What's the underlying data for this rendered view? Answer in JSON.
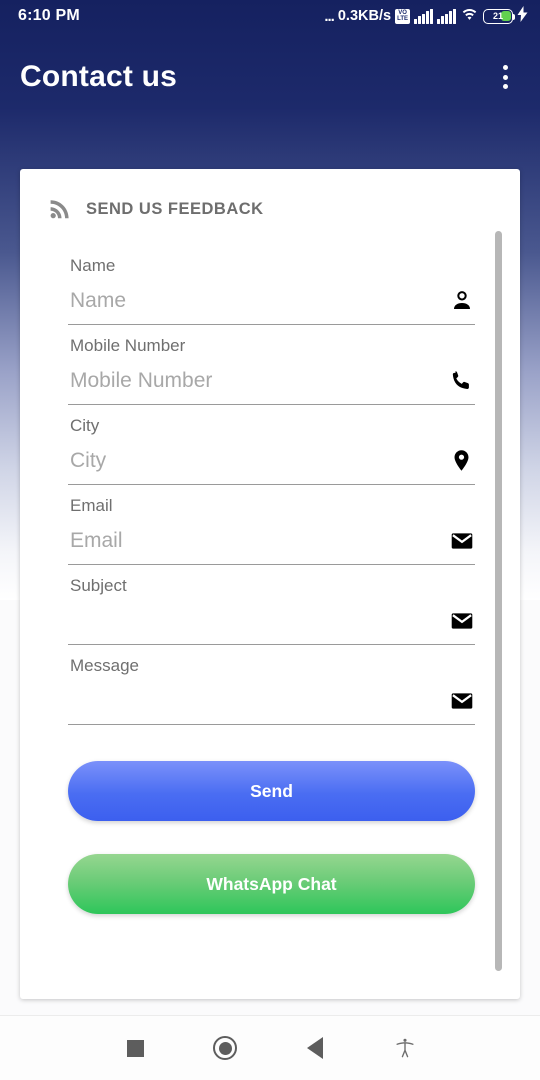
{
  "status_bar": {
    "time": "6:10 PM",
    "dots": "...",
    "network_speed": "0.3KB/s",
    "volte_top": "VO",
    "volte_bottom": "LTE",
    "battery_percent": "21",
    "icons": [
      "volte-icon",
      "signal-bars-sim1-icon",
      "signal-bars-sim2-icon",
      "wifi-icon",
      "battery-icon",
      "charging-bolt-icon"
    ]
  },
  "app_bar": {
    "title": "Contact us",
    "overflow_icon": "more-vert-icon"
  },
  "card": {
    "header_icon": "rss-feed-icon",
    "header_title": "SEND US FEEDBACK",
    "fields": [
      {
        "label": "Name",
        "placeholder": "Name",
        "value": "",
        "icon": "person-icon"
      },
      {
        "label": "Mobile Number",
        "placeholder": "Mobile Number",
        "value": "",
        "icon": "phone-icon"
      },
      {
        "label": "City",
        "placeholder": "City",
        "value": "",
        "icon": "location-pin-icon"
      },
      {
        "label": "Email",
        "placeholder": "Email",
        "value": "",
        "icon": "email-icon"
      },
      {
        "label": "Subject",
        "placeholder": "",
        "value": "",
        "icon": "email-icon"
      },
      {
        "label": "Message",
        "placeholder": "",
        "value": "",
        "icon": "email-icon"
      }
    ],
    "buttons": {
      "send": "Send",
      "whatsapp": "WhatsApp Chat"
    }
  },
  "nav_bar": {
    "recents": "recents-square-icon",
    "home": "home-circle-icon",
    "back": "back-triangle-icon",
    "accessibility": "accessibility-icon"
  },
  "colors": {
    "app_bar_dark": "#152160",
    "send_button": "#4a6df2",
    "whatsapp_button": "#2ec65a",
    "battery_fill": "#62d14f",
    "card_background": "#ffffff"
  }
}
